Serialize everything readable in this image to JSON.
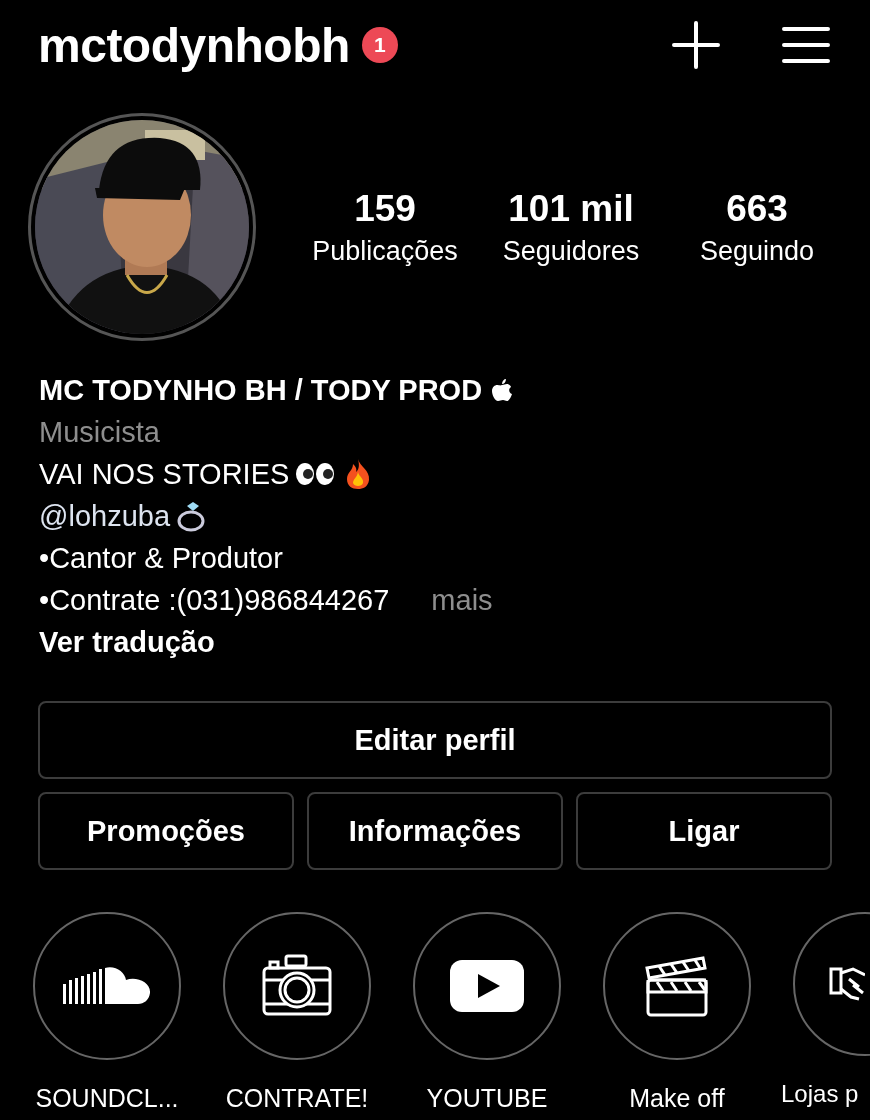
{
  "header": {
    "username": "mctodynhobh",
    "notification_count": "1"
  },
  "stats": [
    {
      "value": "159",
      "label": "Publicações"
    },
    {
      "value": "101 mil",
      "label": "Seguidores"
    },
    {
      "value": "663",
      "label": "Seguindo"
    }
  ],
  "profile": {
    "name": "MC TODYNHO BH / TODY PROD",
    "category": "Musicista",
    "bio": [
      {
        "kind": "text",
        "text": "VAI NOS STORIES"
      },
      {
        "kind": "mention",
        "text": "@lohzuba"
      },
      {
        "kind": "text",
        "text": "•Cantor & Produtor"
      },
      {
        "kind": "text",
        "text": "•Contrate :(031)986844267",
        "more": "mais"
      }
    ],
    "translate": "Ver tradução"
  },
  "buttons": [
    {
      "label": "Editar perfil"
    },
    {
      "label": "Promoções"
    },
    {
      "label": "Informações"
    },
    {
      "label": "Ligar"
    }
  ],
  "highlights": [
    {
      "label": "SOUNDCL..."
    },
    {
      "label": "CONTRATE!"
    },
    {
      "label": "YOUTUBE"
    },
    {
      "label": "Make off"
    },
    {
      "label": "Lojas p"
    }
  ]
}
